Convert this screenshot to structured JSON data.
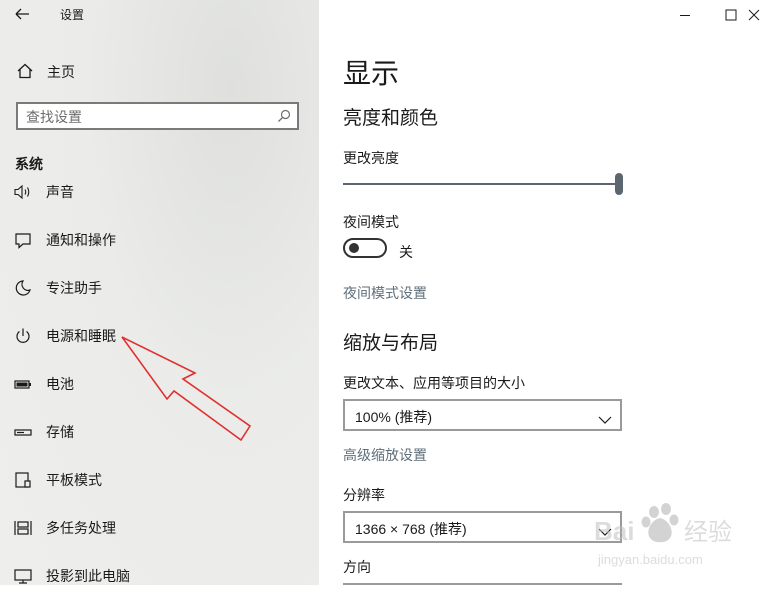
{
  "window": {
    "title": "设置",
    "controls": [
      "minimize-icon",
      "maximize-icon",
      "close-icon"
    ]
  },
  "sidebar": {
    "home_label": "主页",
    "search_placeholder": "查找设置",
    "section_label": "系统",
    "items": [
      {
        "label": "声音",
        "icon": "speaker-icon"
      },
      {
        "label": "通知和操作",
        "icon": "notification-icon"
      },
      {
        "label": "专注助手",
        "icon": "moon-icon"
      },
      {
        "label": "电源和睡眠",
        "icon": "power-icon"
      },
      {
        "label": "电池",
        "icon": "battery-icon"
      },
      {
        "label": "存储",
        "icon": "storage-icon"
      },
      {
        "label": "平板模式",
        "icon": "tablet-mode-icon"
      },
      {
        "label": "多任务处理",
        "icon": "multitasking-icon"
      },
      {
        "label": "投影到此电脑",
        "icon": "projecting-icon"
      }
    ]
  },
  "main": {
    "title": "显示",
    "brightness_section": "亮度和颜色",
    "brightness_label": "更改亮度",
    "brightness_value": 1.0,
    "night_mode_label": "夜间模式",
    "night_mode_state": "关",
    "night_mode_settings_link": "夜间模式设置",
    "scale_section": "缩放与布局",
    "scale_label": "更改文本、应用等项目的大小",
    "scale_value": "100% (推荐)",
    "advanced_scale_link": "高级缩放设置",
    "resolution_label": "分辨率",
    "resolution_value": "1366 × 768 (推荐)",
    "orientation_label": "方向"
  },
  "annotation": {
    "color": "#e0302f"
  },
  "watermark": {
    "brand": "Bai",
    "brand_suffix": "经验",
    "url": "jingyan.baidu.com"
  }
}
